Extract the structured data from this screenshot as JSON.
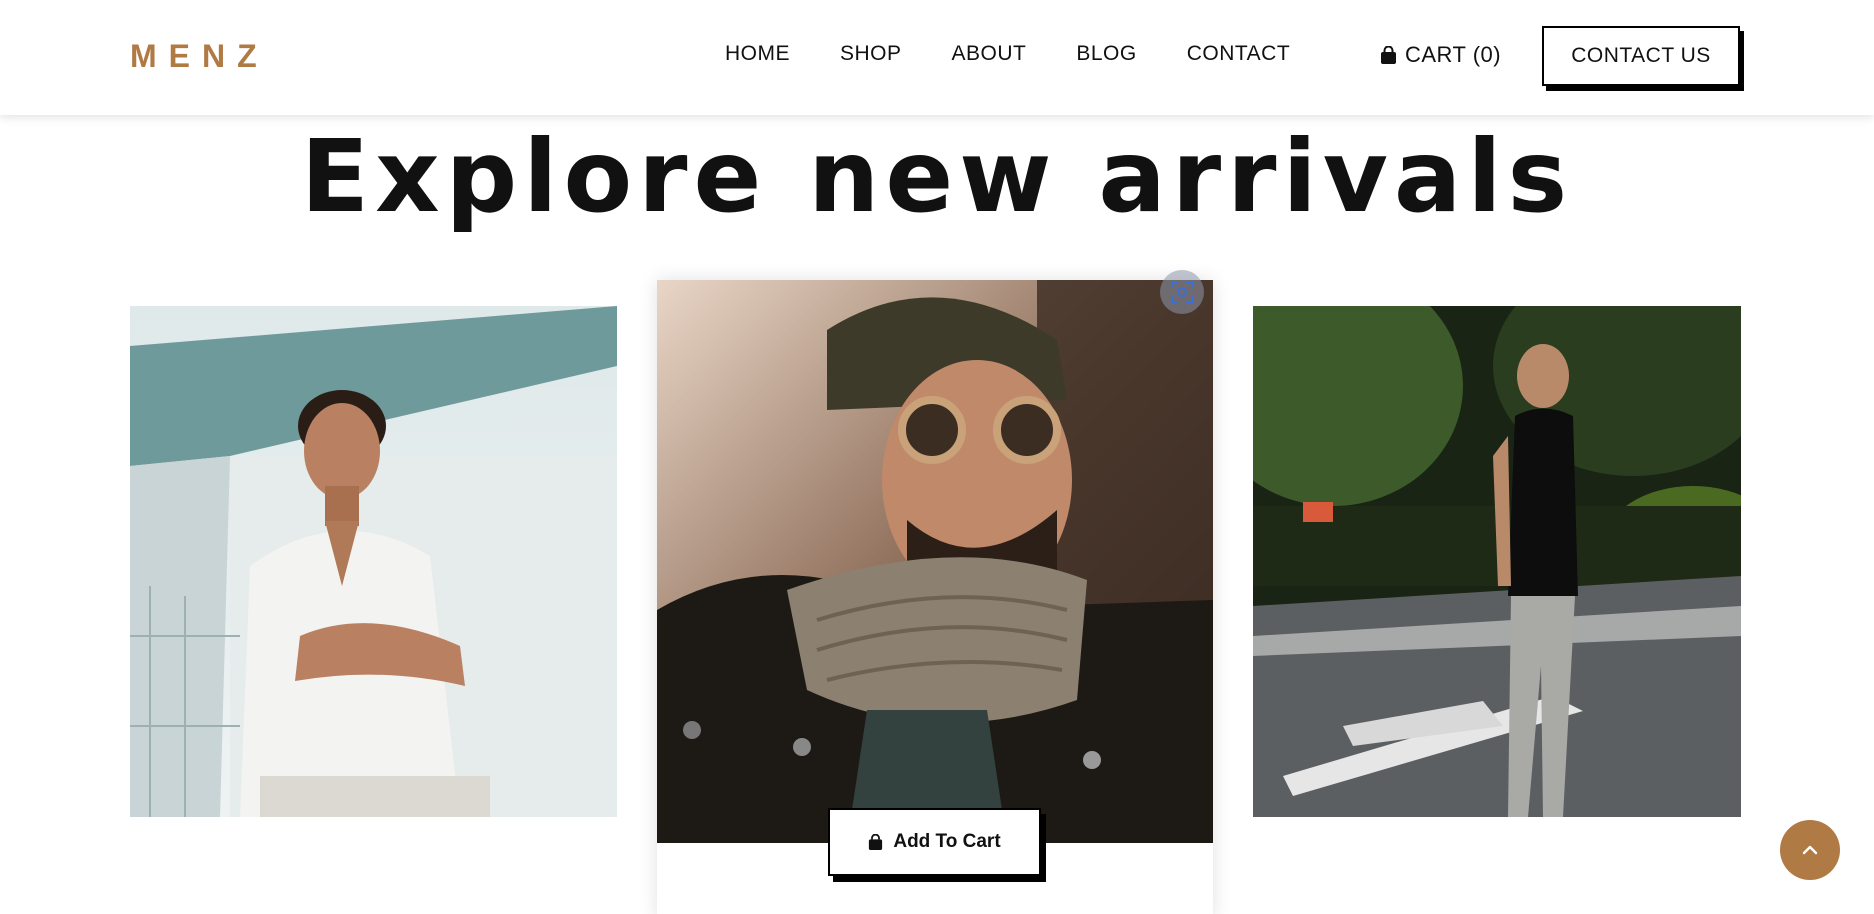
{
  "brand": {
    "logo": "MENZ",
    "color": "#b07a45"
  },
  "nav": {
    "items": [
      "HOME",
      "SHOP",
      "ABOUT",
      "BLOG",
      "CONTACT"
    ]
  },
  "cart": {
    "label": "CART (0)",
    "icon": "shopping-bag-icon"
  },
  "contact_button": {
    "label": "CONTACT US"
  },
  "section": {
    "title": "Explore new arrivals"
  },
  "products": [
    {
      "image": "man-white-shirt-photo"
    },
    {
      "image": "man-sunglasses-scarf-photo",
      "add_to_cart": "Add To Cart"
    },
    {
      "image": "man-black-tshirt-photo"
    }
  ],
  "icons": {
    "scan": "scan-icon",
    "back_to_top": "chevron-up-icon"
  }
}
